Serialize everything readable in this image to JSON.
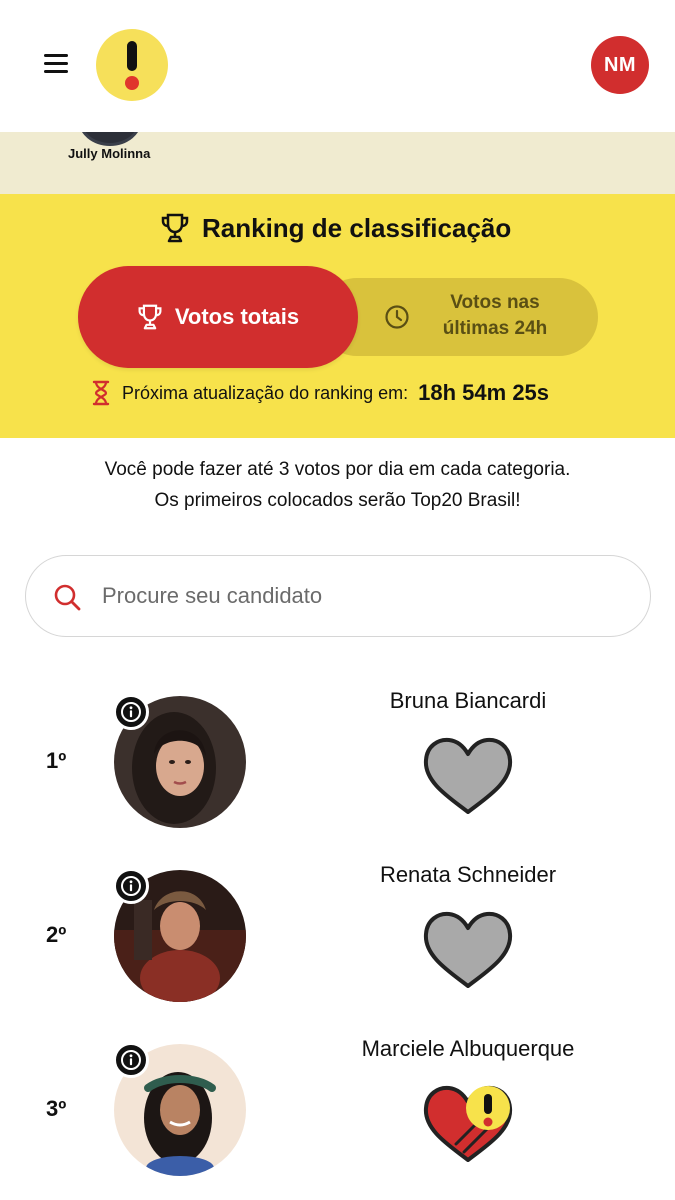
{
  "header": {
    "user_initials": "NM"
  },
  "previous": {
    "name": "Jully Molinna"
  },
  "ranking": {
    "title": "Ranking de classificação",
    "tab_total": "Votos totais",
    "tab_24h": "Votos nas últimas 24h",
    "next_update_label": "Próxima atualização do ranking em:",
    "next_update_time": "18h 54m 25s"
  },
  "info": {
    "line1": "Você pode fazer até 3 votos por dia em cada categoria.",
    "line2": "Os primeiros colocados serão Top20 Brasil!"
  },
  "search": {
    "placeholder": "Procure seu candidato"
  },
  "candidates": [
    {
      "rank": "1º",
      "name": "Bruna Biancardi",
      "voted": false
    },
    {
      "rank": "2º",
      "name": "Renata Schneider",
      "voted": false
    },
    {
      "rank": "3º",
      "name": "Marciele Albuquerque",
      "voted": true
    }
  ],
  "colors": {
    "brand_yellow": "#f7e24b",
    "brand_red": "#d12e2e",
    "inactive_tab": "#d9c23c",
    "beige": "#f0ebd0"
  }
}
